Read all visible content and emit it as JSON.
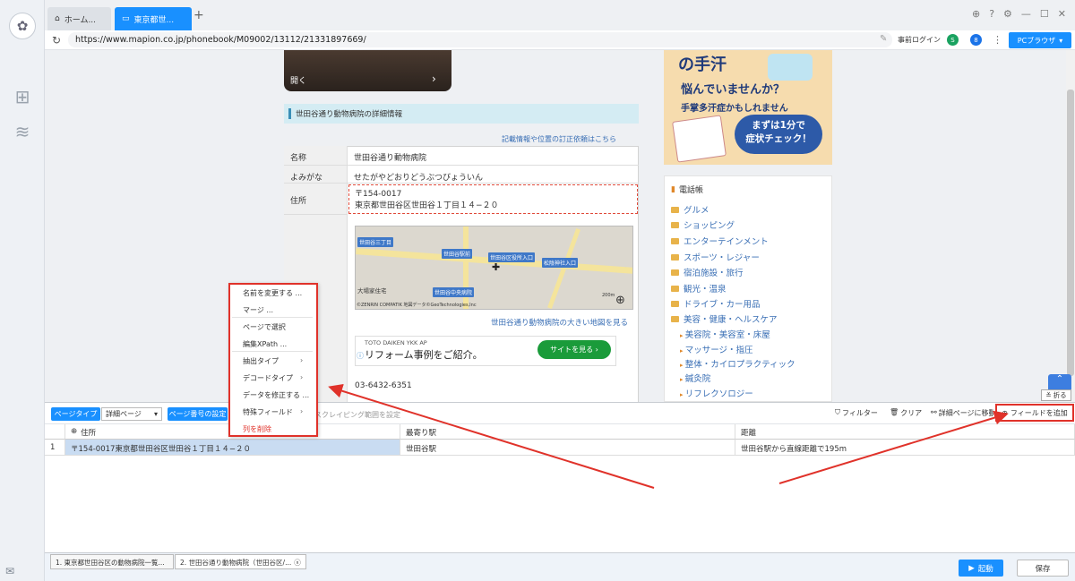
{
  "tabs": [
    {
      "label": "ホーム..."
    },
    {
      "label": "東京都世..."
    }
  ],
  "address": {
    "url": "https://www.mapion.co.jp/phonebook/M09002/13112/21331897669/",
    "login": "事前ログイン",
    "browser_btn": "PCブラウザ"
  },
  "page": {
    "photo_label": "開く",
    "section_title": "世田谷通り動物病院の詳細情報",
    "fix_link": "記載情報や位置の訂正依頼はこちら",
    "rows": [
      {
        "label": "名称",
        "value": "世田谷通り動物病院"
      },
      {
        "label": "よみがな",
        "value": "せたがやどおりどうぶつびょういん"
      },
      {
        "label": "住所",
        "value_line1": "〒154-0017",
        "value_line2": "東京都世田谷区世田谷１丁目１４−２０"
      }
    ],
    "map_labels": [
      "世田谷三丁目",
      "世田谷駅前",
      "世田谷区役所入口",
      "松陰神社入口",
      "世田谷中央病院",
      "大場家住宅"
    ],
    "map_copyright": "©ZENRIN COMPATIK 地図データ©GeoTechnologies,Inc",
    "map_scale": "200m",
    "big_map_link": "世田谷通り動物病院の大きい地図を見る",
    "ad_brand": "TOTO DAIKEN YKK AP",
    "ad_text": "リフォーム事例をご紹介。",
    "ad_button": "サイトを見る",
    "phone": "03-6432-6351"
  },
  "banner": {
    "line1": "の手汗",
    "line2": "悩んでいませんか？",
    "line3": "手掌多汗症かもしれません",
    "bubble1": "まずは1分で",
    "bubble2": "症状チェック！"
  },
  "phonebook": {
    "title": "電話帳",
    "items": [
      "グルメ",
      "ショッピング",
      "エンターテインメント",
      "スポーツ・レジャー",
      "宿泊施設・旅行",
      "観光・温泉",
      "ドライブ・カー用品",
      "美容・健康・ヘルスケア"
    ],
    "subitems": [
      "美容院・美容室・床屋",
      "マッサージ・指圧",
      "整体・カイロプラクティック",
      "鍼灸院",
      "リフレクソロジー"
    ]
  },
  "fold_label": "折る",
  "toolbar": {
    "page_type": "ページタイプ",
    "page_type_value": "詳細ページ",
    "page_no": "ページ番号の設定",
    "scrape_range": "スクレイピング範囲を設定",
    "filter": "フィルター",
    "clear": "クリア",
    "detail": "詳細ページに移動",
    "add_field": "フィールドを追加"
  },
  "grid": {
    "headers": [
      "住所",
      "最寄り駅",
      "距離"
    ],
    "row_no": "1",
    "cells": [
      "〒154-0017東京都世田谷区世田谷１丁目１４−２０",
      "世田谷駅",
      "世田谷駅から直線距離で195m"
    ]
  },
  "context_menu": [
    "名前を変更する ...",
    "マージ ...",
    "ページで選択",
    "編集XPath ...",
    "抽出タイプ",
    "デコードタイプ",
    "データを修正する ...",
    "特殊フィールド",
    "列を削除"
  ],
  "footer": {
    "tab1": "1. 東京都世田谷区の動物病院一覧...",
    "tab2": "2. 世田谷通り動物病院（世田谷区/...",
    "start": "起動",
    "save": "保存"
  },
  "colors": {
    "accent": "#1990ff",
    "highlight": "#e0322a"
  }
}
